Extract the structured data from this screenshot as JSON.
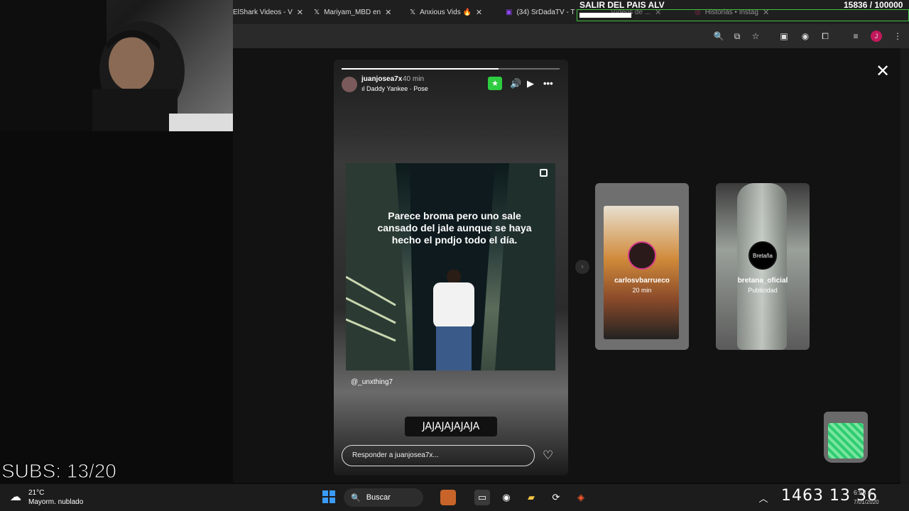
{
  "browser": {
    "tabs": [
      {
        "label": "ElShark Videos - V",
        "icon": "generic-icon"
      },
      {
        "label": "Mariyam_MBD en",
        "icon": "x-logo-icon"
      },
      {
        "label": "Anxious Vids 🔥",
        "icon": "x-logo-icon"
      },
      {
        "label": "(34) SrDadaTV - T",
        "icon": "twitch-icon"
      },
      {
        "label": "Vídeos de ...",
        "icon": "generic-icon"
      },
      {
        "label": "Historias • Instag",
        "icon": "instagram-icon"
      }
    ]
  },
  "overlay": {
    "goal_title": "SALIR DEL PAIS ALV",
    "goal_count": "15836  / 100000",
    "goal_fraction": 0.158,
    "subs": "SUBS: 13/20"
  },
  "story": {
    "username": "juanjosea7x",
    "time": "40 min",
    "song": "Daddy Yankee · Pose",
    "post_text": "Parece broma pero uno sale cansado del jale aunque se haya hecho el pndjo todo el día.",
    "mention": "@_unxthing7",
    "sticker": "JAJAJAJAJAJA",
    "reply_placeholder": "Responder a juanjosea7x...",
    "progress": 0.72
  },
  "next_stories": [
    {
      "name": "carlosvbarrueco",
      "sub": "20 min"
    },
    {
      "name": "bretana_oficial",
      "sub": "Publicidad",
      "logo": "Bretaña"
    }
  ],
  "taskbar": {
    "weather_temp": "21°C",
    "weather_cond": "Mayorm. nublado",
    "search_label": "Buscar",
    "tray_numbers": "1463 13 36",
    "clock": "6:58 p.",
    "date": "7/01/2020"
  },
  "colors": {
    "accent_green": "#2ecc40",
    "instagram_ring": "#d63a8a",
    "windows_blue": "#3a9bff"
  }
}
